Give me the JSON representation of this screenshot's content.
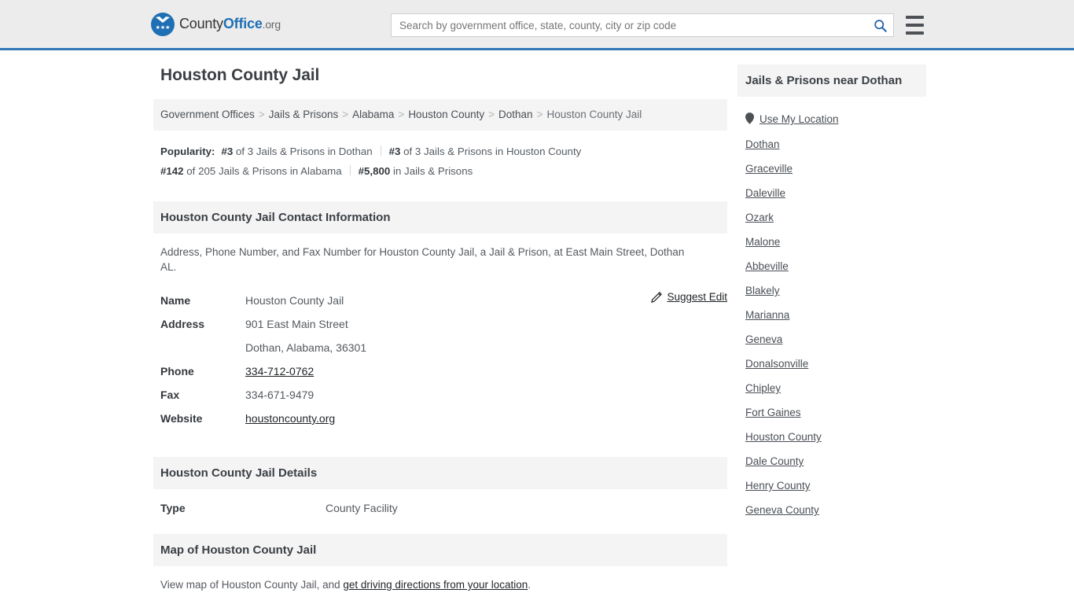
{
  "header": {
    "logo": {
      "part1": "County",
      "part2": "Office",
      "part3": ".org",
      "eagle_glyph": "▼",
      "stars_glyph": "★★★"
    },
    "search": {
      "placeholder": "Search by government office, state, county, city or zip code",
      "value": "",
      "search_icon": "search-icon"
    },
    "menu_icon": "hamburger-menu-icon"
  },
  "main": {
    "title": "Houston County Jail",
    "breadcrumb": {
      "items": [
        {
          "label": "Government Offices",
          "link": true
        },
        {
          "label": "Jails & Prisons",
          "link": true
        },
        {
          "label": "Alabama",
          "link": true
        },
        {
          "label": "Houston County",
          "link": true
        },
        {
          "label": "Dothan",
          "link": true
        },
        {
          "label": "Houston County Jail",
          "link": false
        }
      ],
      "separator": ">"
    },
    "popularity": {
      "label": "Popularity:",
      "items": [
        {
          "rank": "#3",
          "text": " of 3 Jails & Prisons in Dothan"
        },
        {
          "rank": "#3",
          "text": " of 3 Jails & Prisons in Houston County"
        },
        {
          "rank": "#142",
          "text": " of 205 Jails & Prisons in Alabama"
        },
        {
          "rank": "#5,800",
          "text": " in Jails & Prisons"
        }
      ]
    },
    "contact": {
      "heading": "Houston County Jail Contact Information",
      "description": "Address, Phone Number, and Fax Number for Houston County Jail, a Jail & Prison, at East Main Street, Dothan AL.",
      "suggest_edit_label": "Suggest Edit",
      "rows": [
        {
          "key": "Name",
          "value": "Houston County Jail",
          "link": false
        },
        {
          "key": "Address",
          "value": "901 East Main Street",
          "link": false
        },
        {
          "key": "",
          "value": "Dothan, Alabama, 36301",
          "link": false
        },
        {
          "key": "Phone",
          "value": "334-712-0762",
          "link": true
        },
        {
          "key": "Fax",
          "value": "334-671-9479",
          "link": false
        },
        {
          "key": "Website",
          "value": "houstoncounty.org",
          "link": true
        }
      ]
    },
    "details": {
      "heading": "Houston County Jail Details",
      "rows": [
        {
          "key": "Type",
          "value": "County Facility"
        }
      ]
    },
    "map": {
      "heading": "Map of Houston County Jail",
      "text_before": "View map of Houston County Jail, and ",
      "link_label": "get driving directions from your location",
      "text_after": "."
    }
  },
  "sidebar": {
    "heading": "Jails & Prisons near Dothan",
    "use_my_location": "Use My Location",
    "location_icon": "map-pin-icon",
    "items": [
      "Dothan",
      "Graceville",
      "Daleville",
      "Ozark",
      "Malone",
      "Abbeville",
      "Blakely",
      "Marianna",
      "Geneva",
      "Donalsonville",
      "Chipley",
      "Fort Gaines",
      "Houston County",
      "Dale County",
      "Henry County",
      "Geneva County"
    ]
  },
  "colors": {
    "header_bg": "#ececec",
    "header_border": "#3178b5",
    "accent_blue": "#1f6fb5",
    "section_bg": "#f4f4f4",
    "text_dark": "#33383d",
    "text_body": "#55595e"
  }
}
